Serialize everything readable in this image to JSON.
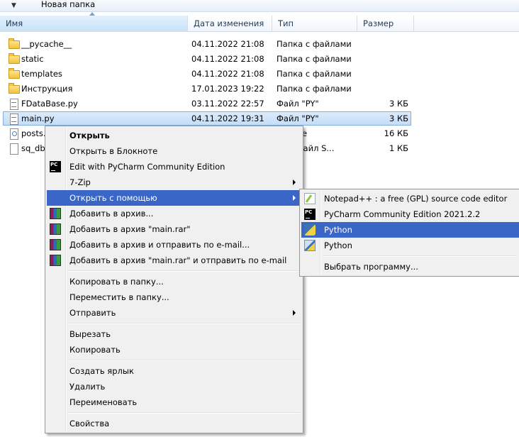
{
  "toolbar": {
    "organize_caret": "▼",
    "new_folder": "Новая папка"
  },
  "columns": {
    "name": "Имя",
    "date": "Дата изменения",
    "type": "Тип",
    "size": "Размер"
  },
  "files": [
    {
      "name": "__pycache__",
      "date": "04.11.2022 21:08",
      "type": "Папка с файлами",
      "size": "",
      "icon": "folder-icon"
    },
    {
      "name": "static",
      "date": "04.11.2022 21:08",
      "type": "Папка с файлами",
      "size": "",
      "icon": "folder-icon"
    },
    {
      "name": "templates",
      "date": "04.11.2022 21:08",
      "type": "Папка с файлами",
      "size": "",
      "icon": "folder-icon"
    },
    {
      "name": "Инструкция",
      "date": "17.01.2023 19:22",
      "type": "Папка с файлами",
      "size": "",
      "icon": "folder-icon"
    },
    {
      "name": "FDataBase.py",
      "date": "03.11.2022 22:57",
      "type": "Файл \"PY\"",
      "size": "3 КБ",
      "icon": "py-file-icon"
    },
    {
      "name": "main.py",
      "date": "04.11.2022 19:31",
      "type": "Файл \"PY\"",
      "size": "3 КБ",
      "icon": "py-file-icon",
      "selected": true
    },
    {
      "name": "posts.",
      "date": "",
      "type": "ase File",
      "size": "16 КБ",
      "icon": "db-file-icon"
    },
    {
      "name": "sq_db",
      "date": "",
      "type": "ный файл S...",
      "size": "1 КБ",
      "icon": "blank-file-icon"
    }
  ],
  "context_menu": {
    "open": "Открыть",
    "open_notepad": "Открыть в Блокноте",
    "edit_pycharm": "Edit with PyCharm Community Edition",
    "seven_zip": "7-Zip",
    "open_with": "Открыть с помощью",
    "add_archive": "Добавить в архив...",
    "add_main_rar": "Добавить в архив \"main.rar\"",
    "add_archive_email": "Добавить в архив и отправить по e-mail...",
    "add_main_rar_email": "Добавить в архив \"main.rar\" и отправить по e-mail",
    "copy_to_folder": "Копировать в папку...",
    "move_to_folder": "Переместить в папку...",
    "send_to": "Отправить",
    "cut": "Вырезать",
    "copy": "Копировать",
    "create_shortcut": "Создать ярлык",
    "delete": "Удалить",
    "rename": "Переименовать",
    "properties": "Свойства"
  },
  "submenu": {
    "notepadpp": "Notepad++ : a free (GPL) source code editor",
    "pycharm": "PyCharm Community Edition 2021.2.2",
    "python1": "Python",
    "python2": "Python",
    "choose_program": "Выбрать программу..."
  },
  "colors": {
    "menu_highlight": "#3a67c7",
    "selection": "#c4ddf7"
  }
}
